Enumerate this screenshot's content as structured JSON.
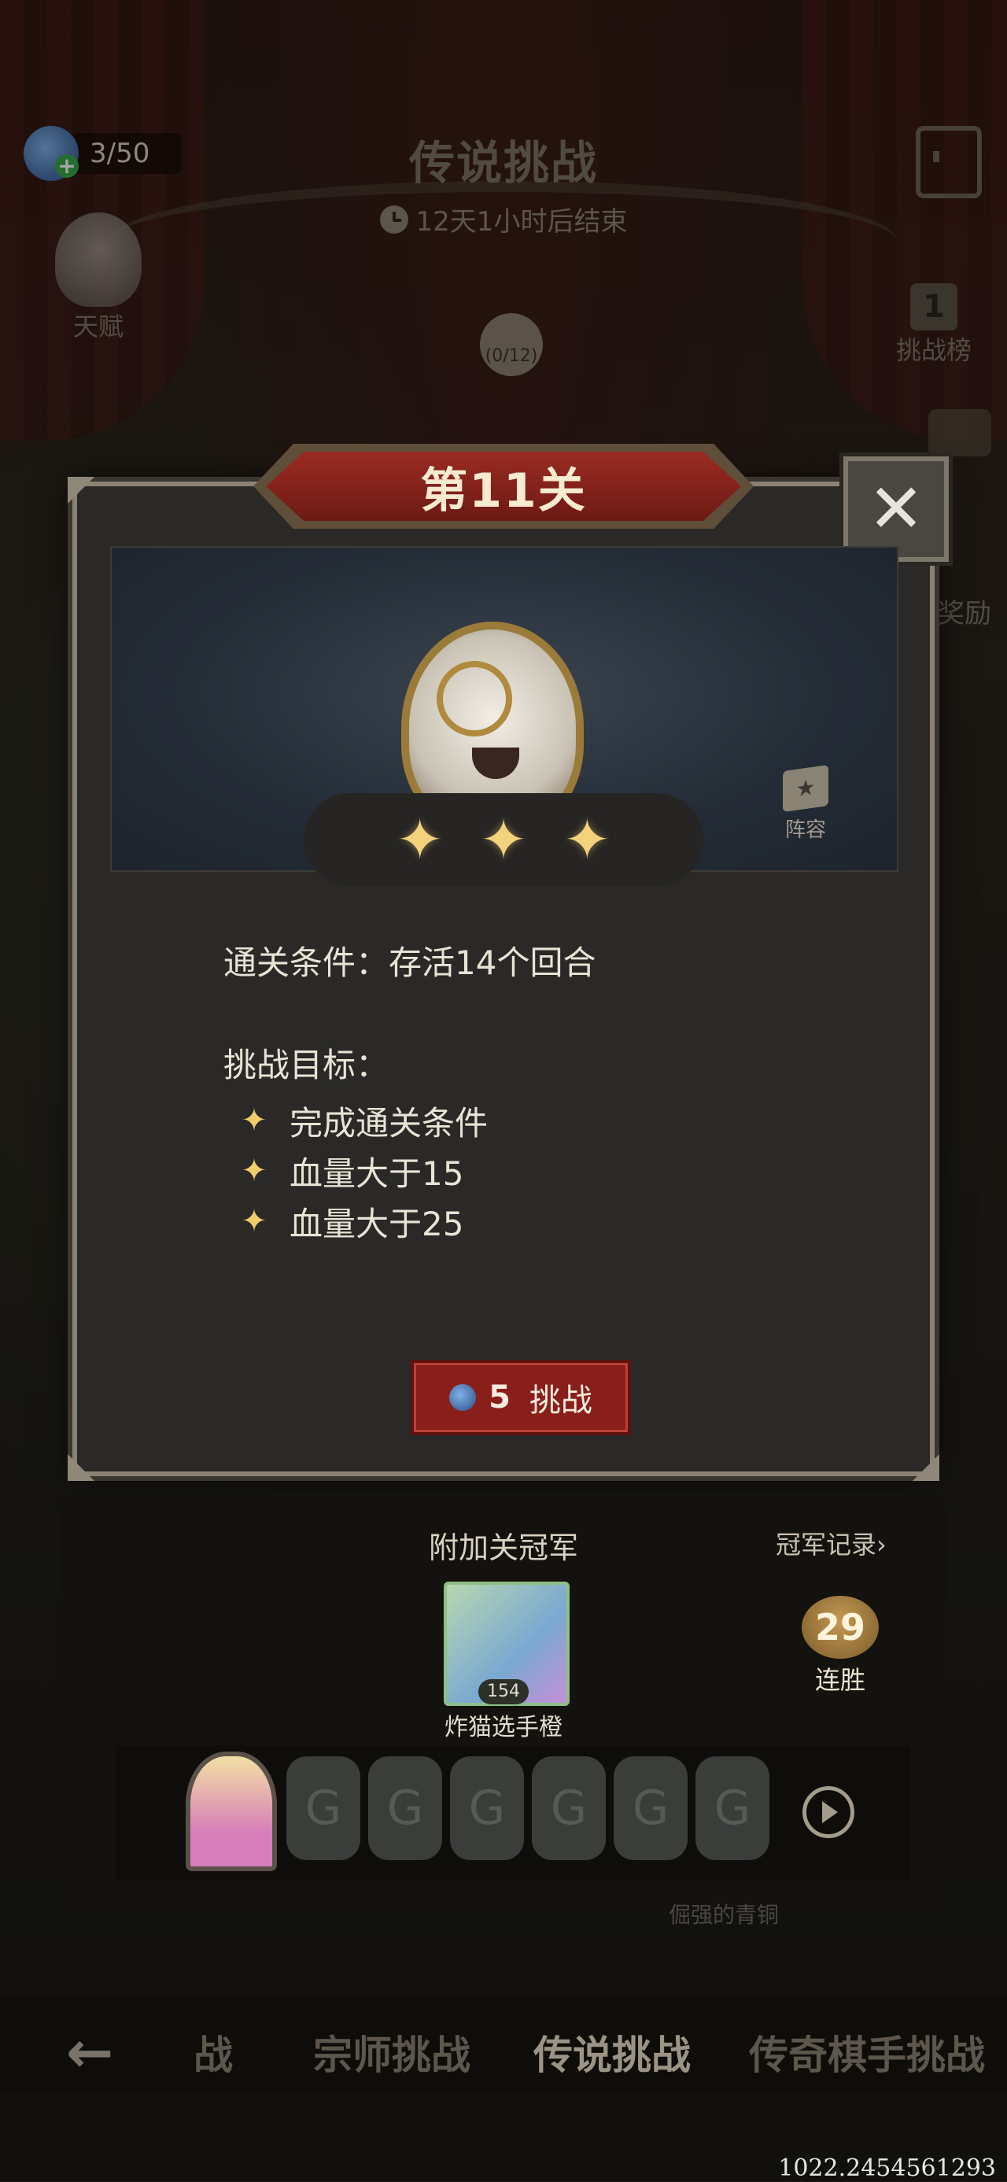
{
  "header": {
    "ticket_count": "3/50",
    "title": "传说挑战",
    "timer": "12天1小时后结束"
  },
  "side": {
    "talent_label": "天赋",
    "leaderboard_label": "挑战榜",
    "leaderboard_rank": "1",
    "reward_label": "奖励",
    "progress_badge": "(0/12)"
  },
  "modal": {
    "level_title": "第11关",
    "close_symbol": "✕",
    "stars": [
      "✦",
      "✦",
      "✦"
    ],
    "lineup_label": "阵容",
    "condition": "通关条件：存活14个回合",
    "goals_heading": "挑战目标：",
    "goals": [
      "完成通关条件",
      "血量大于15",
      "血量大于25"
    ],
    "goal_icon": "✦",
    "challenge_cost": "5",
    "challenge_label": "挑战"
  },
  "champion": {
    "title": "附加关冠军",
    "record_link": "冠军记录›",
    "player_level": "154",
    "player_name": "炸猫选手橙",
    "streak_count": "29",
    "streak_label": "连胜",
    "slot_glyph": "G",
    "faint_text": "倔强的青铜"
  },
  "tabs": [
    "战",
    "宗师挑战",
    "传说挑战",
    "传奇棋手挑战"
  ],
  "active_tab": "传说挑战",
  "back_symbol": "←",
  "coords": "1022.2454561293",
  "colors": {
    "accent_red": "#8a1e1a",
    "star_gold": "#f2d27a"
  }
}
